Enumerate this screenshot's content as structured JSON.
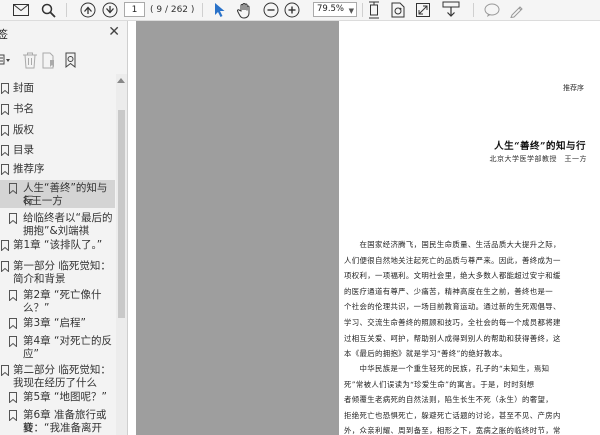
{
  "toolbar": {
    "page_current": "1",
    "page_count": "( 9 / 262 )",
    "zoom": "79.5%",
    "icons": [
      "mail-icon",
      "search-icon",
      "page-up-icon",
      "page-down-icon",
      "select-cursor-icon",
      "hand-icon",
      "zoom-out-icon",
      "zoom-in-icon",
      "fit-page-icon",
      "rotate-icon",
      "fit-width-icon",
      "download-icon",
      "comment-icon",
      "pen-icon"
    ]
  },
  "sidebar": {
    "title": "签",
    "items": [
      {
        "label_lines": [
          "封面"
        ]
      },
      {
        "label_lines": [
          "书名"
        ]
      },
      {
        "label_lines": [
          "版权"
        ]
      },
      {
        "label_lines": [
          "目录"
        ]
      },
      {
        "label_lines": [
          "推荐序"
        ]
      },
      {
        "label_lines": [
          "人生“善终”的知与行",
          "&王一方"
        ]
      },
      {
        "label_lines": [
          "给临终者以“最后的",
          "拥抱”&刘端祺"
        ]
      },
      {
        "label_lines": [
          "第1章 “该排队了。”"
        ]
      },
      {
        "label_lines": [
          "第一部分 临死觉知：",
          "简介和背景"
        ]
      },
      {
        "label_lines": [
          "第2章 “死亡像什",
          "么？”"
        ]
      },
      {
        "label_lines": [
          "第3章 “启程”"
        ]
      },
      {
        "label_lines": [
          "第4章 “对死亡的反",
          "应”"
        ]
      },
      {
        "label_lines": [
          "第二部分 临死觉知：",
          "我现在经历了什么"
        ]
      },
      {
        "label_lines": [
          "第5章 “地图呢？”"
        ]
      },
      {
        "label_lines": [
          "第6章 准备旅行或转",
          "变：“我准备离开"
        ]
      }
    ]
  },
  "document": {
    "running_header": "推荐序",
    "chapter_title": "人生“善终”的知与行",
    "author_line": "北京大学医学部教授　王一方",
    "paragraph1": [
      "　　在国家经济腾飞，国民生命质量、生活品质大大提升之际，",
      "人们便很自然地关注起死亡的品质与尊严来。因此，善终成为一",
      "项权利，一项福利。文明社会里，绝大多数人都能超过安宁和缓",
      "的医疗通道有尊严、少痛苦，精神高度在生之前，善终也是一",
      "个社会的伦理共识，一场目前教育运动。通过新的生死观倡导、",
      "学习、交流生命善终的照顾和技巧，全社会的每一个成员都将建",
      "过相互关爱、呵护，帮助别人成得到别人的帮助和获得善终，这",
      "本《最后的拥抱》就是学习“善终”的绝好教本。"
    ],
    "paragraph2": [
      "　　中华民族是一个重生轻死的民族，孔子的“未知生，焉知",
      "死”常被人们误读为“珍爱生命”的寓言。于是，时时刻想",
      "者倾覆生老病死的自然法则，陷生长生不死（永生）的奢望，",
      "拒绝死亡也恐惧死亡，躲避死亡话题的讨论，甚至不见、产房内",
      "外，众亲利耀、周到备至，相形之下，宽病之胀的临终时节，常"
    ]
  }
}
